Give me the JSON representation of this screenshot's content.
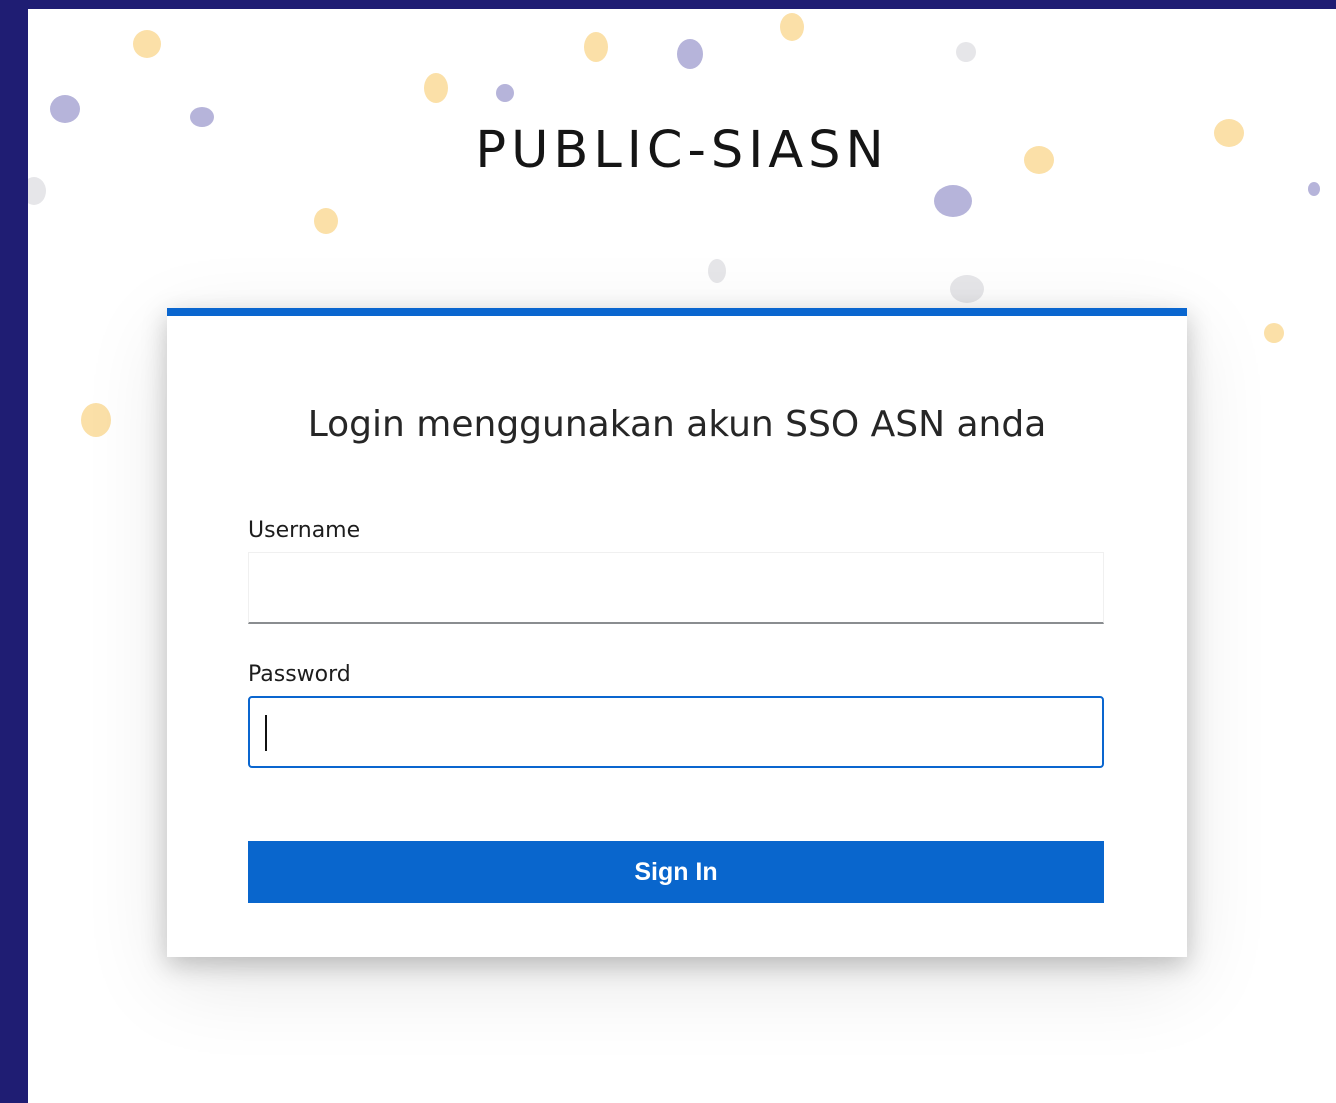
{
  "brand": {
    "title": "PUBLIC-SIASN"
  },
  "login_card": {
    "heading": "Login menggunakan akun SSO ASN anda",
    "username_label": "Username",
    "username_value": "",
    "password_label": "Password",
    "password_value": "",
    "sign_in_label": "Sign In"
  },
  "colors": {
    "page_border": "#1f1d73",
    "accent": "#0a66cf",
    "dot_yellow": "#fbe0a8",
    "dot_purple": "#b6b4da",
    "dot_gray": "#e6e6e9"
  }
}
